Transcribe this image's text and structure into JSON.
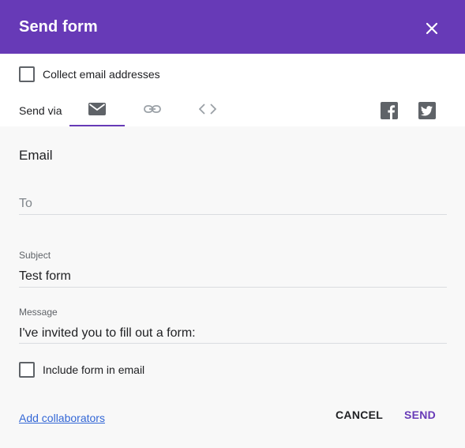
{
  "header": {
    "title": "Send form",
    "close_icon": "close-icon"
  },
  "collect_email": {
    "label": "Collect email addresses",
    "checked": false
  },
  "send_via": {
    "label": "Send via",
    "tabs": [
      {
        "icon": "email-icon",
        "active": true
      },
      {
        "icon": "link-icon",
        "active": false
      },
      {
        "icon": "embed-icon",
        "active": false
      }
    ],
    "social": [
      {
        "icon": "facebook-icon"
      },
      {
        "icon": "twitter-icon"
      }
    ]
  },
  "email": {
    "title": "Email",
    "to": {
      "placeholder": "To",
      "value": ""
    },
    "subject": {
      "label": "Subject",
      "value": "Test form"
    },
    "message": {
      "label": "Message",
      "value": "I've invited you to fill out a form:"
    },
    "include_form": {
      "label": "Include form in email",
      "checked": false
    }
  },
  "footer": {
    "add_collaborators": "Add collaborators",
    "cancel_label": "CANCEL",
    "send_label": "SEND"
  },
  "colors": {
    "accent": "#673ab7",
    "link": "#3367d6",
    "body_bg": "#f8f8f8"
  }
}
